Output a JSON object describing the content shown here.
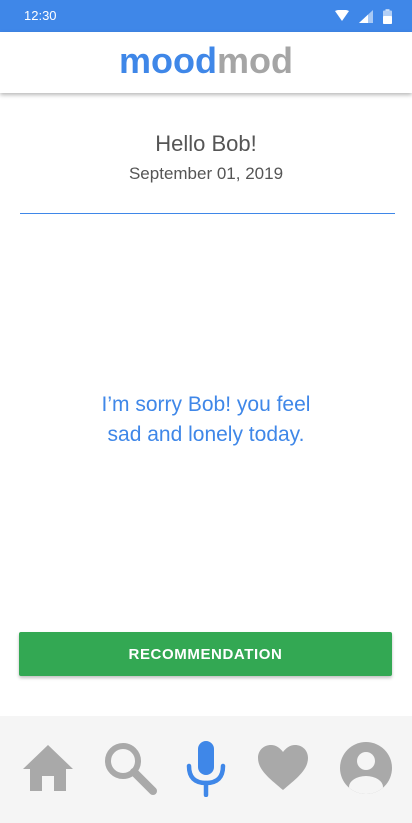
{
  "status_bar": {
    "time": "12:30",
    "icons": [
      "wifi-icon",
      "signal-icon",
      "battery-icon"
    ]
  },
  "app_bar": {
    "logo_part1": "mood",
    "logo_part2": "mod",
    "logo_colors": {
      "part1": "#3f87e8",
      "part2": "#a5a5a5"
    }
  },
  "main": {
    "greeting": "Hello Bob!",
    "date": "September 01, 2019",
    "mood_line1": "I’m sorry Bob! you feel",
    "mood_line2": "sad and lonely today."
  },
  "recommend_button": {
    "label": "RECOMMENDATION",
    "color": "#33a853"
  },
  "bottom_nav": {
    "items": [
      {
        "icon": "home-icon",
        "active": false
      },
      {
        "icon": "search-icon",
        "active": false
      },
      {
        "icon": "microphone-icon",
        "active": true
      },
      {
        "icon": "heart-icon",
        "active": false
      },
      {
        "icon": "account-icon",
        "active": false
      }
    ],
    "active_color": "#3f87e8",
    "inactive_color": "#a9a9a9"
  },
  "colors": {
    "status_bar": "#3f87e8",
    "text_primary": "#555555",
    "accent": "#3f87e8"
  }
}
